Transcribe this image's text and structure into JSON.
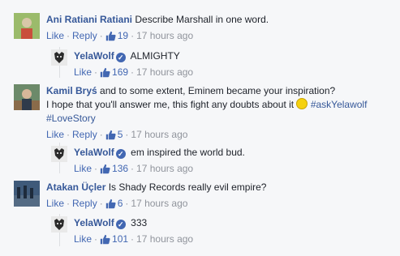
{
  "comments": [
    {
      "author": "Ani Ratiani Ratiani",
      "text": "Describe Marshall in one word.",
      "like": "Like",
      "reply": "Reply",
      "likes": "19",
      "time": "17 hours ago",
      "avatar_colors": [
        "#7b9f55",
        "#d8c7a8",
        "#6f4c3a"
      ]
    },
    {
      "author": "YelaWolf",
      "verified": true,
      "text": "ALMIGHTY",
      "like": "Like",
      "likes": "169",
      "time": "17 hours ago"
    },
    {
      "author": "Kamil Bryś",
      "text_parts": [
        "and to some extent, Eminem became your inspiration?",
        "I hope that you'll answer me, this fight any doubts about it"
      ],
      "hashtags": [
        "#askYelawolf",
        "#LoveStory"
      ],
      "like": "Like",
      "reply": "Reply",
      "likes": "5",
      "time": "17 hours ago"
    },
    {
      "author": "YelaWolf",
      "verified": true,
      "text": "em inspired the world bud.",
      "like": "Like",
      "likes": "136",
      "time": "17 hours ago"
    },
    {
      "author": "Atakan Üçler",
      "text": "Is Shady Records really evil empire?",
      "like": "Like",
      "reply": "Reply",
      "likes": "6",
      "time": "17 hours ago"
    },
    {
      "author": "YelaWolf",
      "verified": true,
      "text": "333",
      "like": "Like",
      "likes": "101",
      "time": "17 hours ago"
    }
  ],
  "colors": {
    "link": "#365899",
    "action": "#4267b2",
    "meta": "#90949c",
    "background": "#f6f7f9"
  },
  "icons": [
    "thumbs-up-icon",
    "verified-badge-icon",
    "smile-emoji-icon"
  ]
}
